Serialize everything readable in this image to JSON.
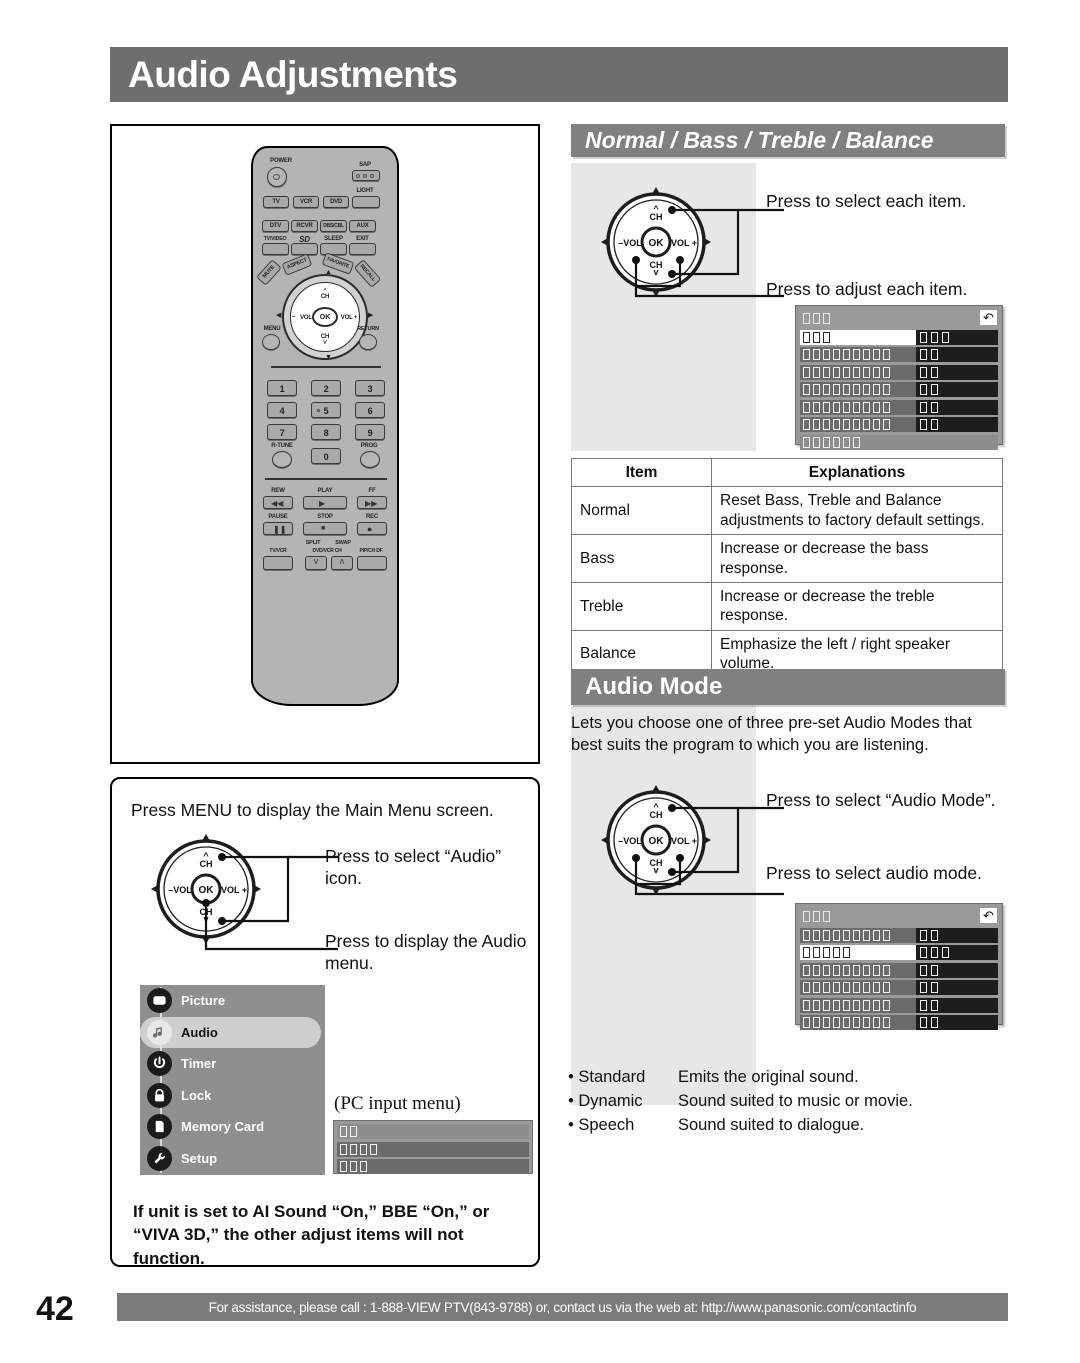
{
  "page": {
    "title": "Audio Adjustments",
    "number": "42"
  },
  "footer": {
    "text": "For assistance, please call : 1-888-VIEW PTV(843-9788) or, contact us via the web at: http://www.panasonic.com/contactinfo"
  },
  "remote": {
    "power_label": "POWER",
    "sap_label": "SAP",
    "light_label": "LIGHT",
    "device_row1": [
      "TV",
      "VCR",
      "DVD"
    ],
    "device_row2": [
      "DTV",
      "RCVR",
      "DBS/CBL",
      "AUX"
    ],
    "func_row": [
      "TV/VIDEO",
      "SD",
      "SLEEP",
      "EXIT"
    ],
    "arc_buttons": [
      "MUTE",
      "ASPECT",
      "FAVORITE",
      "RECALL"
    ],
    "disc": {
      "ch_up": "CH",
      "ch_down": "CH",
      "vol_minus": "VOL",
      "vol_plus": "VOL +",
      "ok": "OK"
    },
    "menu_label": "MENU",
    "return_label": "RETURN",
    "keypad": [
      "1",
      "2",
      "3",
      "4",
      "5",
      "6",
      "7",
      "8",
      "9",
      "0"
    ],
    "rtune_label": "R-TUNE",
    "prog_label": "PROG",
    "transport_row1": [
      "REW",
      "PLAY",
      "FF"
    ],
    "transport_row2": [
      "PAUSE",
      "STOP",
      "REC"
    ],
    "transport_row3": [
      "TV/VCR",
      "DVD/VCR CH",
      "PIP/CH DF"
    ],
    "split_label": "SPLIT",
    "swap_label": "SWAP"
  },
  "section_normal": {
    "heading": "Normal / Bass / Treble / Balance",
    "callout_select": "Press to select each item.",
    "callout_adjust": "Press to adjust each item.",
    "table": {
      "headers": [
        "Item",
        "Explanations"
      ],
      "rows": [
        {
          "item": "Normal",
          "explanation": "Reset Bass, Treble and Balance adjustments to factory default settings."
        },
        {
          "item": "Bass",
          "explanation": "Increase or decrease the bass response."
        },
        {
          "item": "Treble",
          "explanation": "Increase or decrease the treble response."
        },
        {
          "item": "Balance",
          "explanation": "Emphasize the left / right speaker volume."
        }
      ]
    },
    "osd": {
      "return_icon": "return-arrow-icon",
      "rows": [
        {
          "type": "head",
          "labels": 3,
          "bar": 0
        },
        {
          "type": "sel",
          "labels": 3,
          "bar": 3
        },
        {
          "type": "dark",
          "labels": 9,
          "bar": 2
        },
        {
          "type": "dark",
          "labels": 9,
          "bar": 2
        },
        {
          "type": "dark",
          "labels": 9,
          "bar": 2
        },
        {
          "type": "dark",
          "labels": 9,
          "bar": 2
        },
        {
          "type": "dark",
          "labels": 9,
          "bar": 2
        },
        {
          "type": "plain",
          "labels": 6,
          "bar": 0
        }
      ]
    }
  },
  "section_audio_mode": {
    "heading": "Audio Mode",
    "intro": "Lets you choose one of three pre-set Audio Modes that best suits the program to which you are listening.",
    "callout_select_mode": "Press to select “Audio Mode”.",
    "callout_select_audio": "Press to select audio mode.",
    "modes": [
      {
        "name": "• Standard",
        "desc": "Emits the original sound."
      },
      {
        "name": "• Dynamic",
        "desc": "Sound suited to music or movie."
      },
      {
        "name": "• Speech",
        "desc": "Sound suited to dialogue."
      }
    ],
    "osd": {
      "return_icon": "return-arrow-icon",
      "rows": [
        {
          "type": "head",
          "labels": 3,
          "bar": 0
        },
        {
          "type": "dark",
          "labels": 9,
          "bar": 2
        },
        {
          "type": "sel",
          "labels": 5,
          "bar": 3
        },
        {
          "type": "dark",
          "labels": 9,
          "bar": 2
        },
        {
          "type": "dark",
          "labels": 9,
          "bar": 2
        },
        {
          "type": "dark",
          "labels": 9,
          "bar": 2
        },
        {
          "type": "dark",
          "labels": 9,
          "bar": 2
        }
      ]
    }
  },
  "instructions": {
    "menu_intro": "Press MENU to display the Main Menu screen.",
    "callout_select_audio": "Press to select “Audio” icon.",
    "callout_display_menu": "Press to display the Audio menu.",
    "pc_input_caption": "(PC input menu)",
    "note": "If unit is set to AI Sound “On,” BBE “On,” or “VIVA 3D,” the other adjust items will not function.",
    "main_menu": [
      {
        "label": "Picture",
        "icon": "picture-icon",
        "active": false
      },
      {
        "label": "Audio",
        "icon": "audio-note-icon",
        "active": true
      },
      {
        "label": "Timer",
        "icon": "timer-power-icon",
        "active": false
      },
      {
        "label": "Lock",
        "icon": "lock-padlock-icon",
        "active": false
      },
      {
        "label": "Memory Card",
        "icon": "memory-card-icon",
        "active": false
      },
      {
        "label": "Setup",
        "icon": "setup-wrench-icon",
        "active": false
      }
    ],
    "pc_osd": {
      "rows": [
        {
          "type": "plain",
          "labels": 2
        },
        {
          "type": "dark",
          "labels": 4
        },
        {
          "type": "dark",
          "labels": 3
        }
      ]
    }
  },
  "colors": {
    "header_gray": "#6e6e6e",
    "section_gray": "#808080",
    "panel_gray": "#e7e7e7",
    "osd_gray": "#9a9a9a",
    "menu_gray": "#8f8f8f"
  }
}
